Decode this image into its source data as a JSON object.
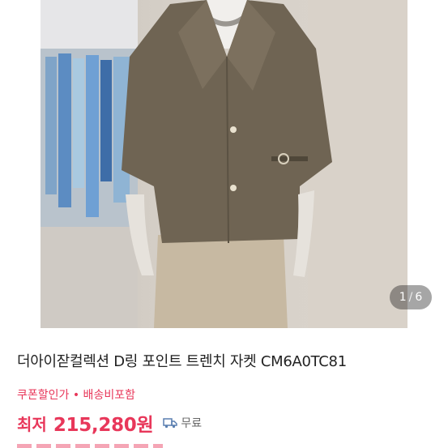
{
  "product": {
    "title": "더아이잗컬렉션 D링 포인트 트렌치 자켓 CM6A0TC81",
    "image_counter": {
      "current": "1",
      "separator": "/",
      "total": "6"
    }
  },
  "pricing": {
    "promo_text": "쿠폰할인가 • 배송비포함",
    "price_label": "최저",
    "price": "215,280원",
    "shipping_label": "무료"
  },
  "colors": {
    "accent": "#e8375a",
    "jacket": "#6f6453",
    "wall": "#d6d0c8"
  },
  "icons": {
    "shipping": "delivery-truck-icon"
  }
}
